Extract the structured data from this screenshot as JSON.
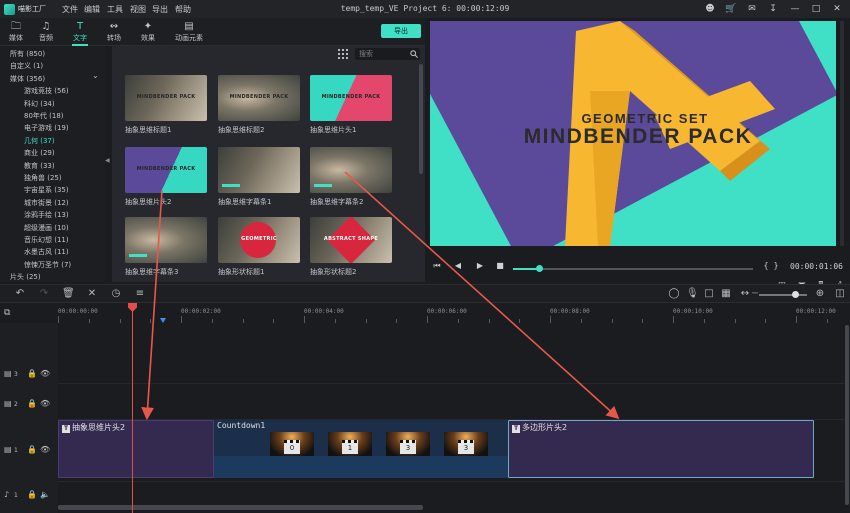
{
  "app": {
    "name": "喵影工厂",
    "window_title": "temp_temp_VE Project 6: 00:00:12:09"
  },
  "menu": [
    "文件",
    "编辑",
    "工具",
    "视图",
    "导出",
    "帮助"
  ],
  "window_controls": [
    "account-icon",
    "cart-icon",
    "message-icon",
    "download-icon",
    "minimize-icon",
    "maximize-icon",
    "close-icon"
  ],
  "tabs": [
    {
      "label": "媒体",
      "icon": "folder-icon",
      "active": false
    },
    {
      "label": "音频",
      "icon": "music-note-icon",
      "active": false
    },
    {
      "label": "文字",
      "icon": "text-icon",
      "active": true
    },
    {
      "label": "转场",
      "icon": "transition-icon",
      "active": false
    },
    {
      "label": "效果",
      "icon": "effects-icon",
      "active": false
    },
    {
      "label": "动画元素",
      "icon": "image-icon",
      "active": false
    }
  ],
  "export_label": "导出",
  "sidebar": [
    {
      "label": "所有 (850)",
      "indent": 0
    },
    {
      "label": "自定义 (1)",
      "indent": 0
    },
    {
      "label": "媒体 (356)",
      "indent": 0,
      "expanded": true
    },
    {
      "label": "游戏竞技 (56)",
      "indent": 1
    },
    {
      "label": "科幻 (34)",
      "indent": 1
    },
    {
      "label": "80年代 (18)",
      "indent": 1
    },
    {
      "label": "电子游戏 (19)",
      "indent": 1
    },
    {
      "label": "几何 (37)",
      "indent": 1,
      "active": true
    },
    {
      "label": "商业 (29)",
      "indent": 1
    },
    {
      "label": "教育 (33)",
      "indent": 1
    },
    {
      "label": "独角兽 (25)",
      "indent": 1
    },
    {
      "label": "宇宙星系 (35)",
      "indent": 1
    },
    {
      "label": "城市街景 (12)",
      "indent": 1
    },
    {
      "label": "涂鸦手绘 (13)",
      "indent": 1
    },
    {
      "label": "超级漫画 (10)",
      "indent": 1
    },
    {
      "label": "音乐幻想 (11)",
      "indent": 1
    },
    {
      "label": "水墨古风 (11)",
      "indent": 1
    },
    {
      "label": "惊悚万圣节 (7)",
      "indent": 1
    },
    {
      "label": "片头 (25)",
      "indent": 0
    }
  ],
  "search": {
    "placeholder": "搜索",
    "value": ""
  },
  "grid_items": [
    {
      "label": "抽象思维标题1",
      "style": "photo",
      "overlay": "MINDBENDER PACK"
    },
    {
      "label": "抽象思维标题2",
      "style": "photo2",
      "overlay": "MINDBENDER PACK"
    },
    {
      "label": "抽象思维片头1",
      "style": "teal-pink",
      "overlay": "MINDBENDER PACK"
    },
    {
      "label": "抽象思维片头2",
      "style": "purple-teal",
      "overlay": "MINDBENDER PACK"
    },
    {
      "label": "抽象思维字幕条1",
      "style": "photo",
      "overlay": ""
    },
    {
      "label": "抽象思维字幕条2",
      "style": "photo2",
      "overlay": ""
    },
    {
      "label": "抽象思维字幕条3",
      "style": "photo2",
      "overlay": ""
    },
    {
      "label": "抽象形状标题1",
      "style": "photo-circle",
      "overlay": "GEOMETRIC"
    },
    {
      "label": "抽象形状标题2",
      "style": "photo-hex",
      "overlay": "ABSTRACT SHAPE"
    }
  ],
  "preview": {
    "subtitle": "GEOMETRIC SET",
    "title": "MINDBENDER PACK",
    "timecode": "00:00:01:06",
    "progress": 0.11,
    "colors": {
      "teal": "#3fe0c6",
      "purple": "#5b4a99",
      "yellow": "#f7b731"
    }
  },
  "ruler_labels": [
    "00:00:00:00",
    "00:00:02:00",
    "00:00:04:00",
    "00:00:06:00",
    "00:00:08:00",
    "00:00:10:00",
    "00:00:12:00"
  ],
  "tracks": [
    {
      "label": "3",
      "type": "video"
    },
    {
      "label": "2",
      "type": "video"
    },
    {
      "label": "1",
      "type": "video"
    },
    {
      "label": "1",
      "type": "audio"
    }
  ],
  "clips": {
    "title1": "抽象思维片头2",
    "countdown": "Countdown1",
    "countdown_numbers": [
      "0",
      "1",
      "3",
      "3"
    ],
    "title2": "多边形片头2"
  },
  "zoom_level": 0.76
}
